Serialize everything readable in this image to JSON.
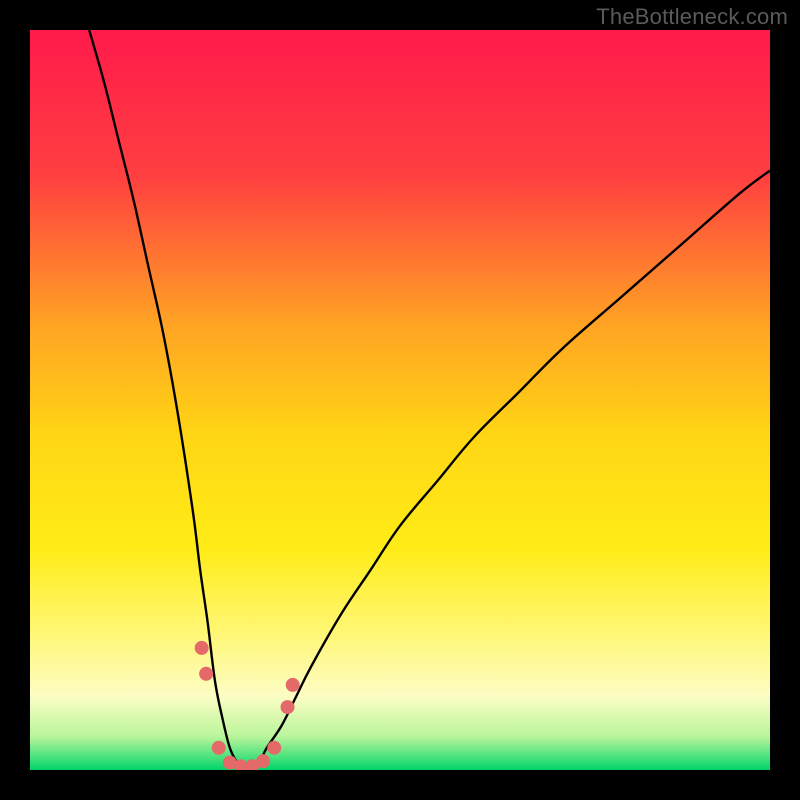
{
  "watermark": "TheBottleneck.com",
  "chart_data": {
    "type": "line",
    "title": "",
    "xlabel": "",
    "ylabel": "",
    "xlim": [
      0,
      100
    ],
    "ylim": [
      0,
      100
    ],
    "background_gradient": {
      "stops": [
        {
          "offset": 0.0,
          "color": "#ff1a4b"
        },
        {
          "offset": 0.2,
          "color": "#ff4040"
        },
        {
          "offset": 0.4,
          "color": "#ffa423"
        },
        {
          "offset": 0.55,
          "color": "#ffd614"
        },
        {
          "offset": 0.7,
          "color": "#ffec17"
        },
        {
          "offset": 0.82,
          "color": "#fff77a"
        },
        {
          "offset": 0.9,
          "color": "#fdfdc4"
        },
        {
          "offset": 0.955,
          "color": "#b8f59a"
        },
        {
          "offset": 0.985,
          "color": "#3fe07a"
        },
        {
          "offset": 1.0,
          "color": "#00d46a"
        }
      ]
    },
    "series": [
      {
        "name": "bottleneck-curve",
        "color": "#000000",
        "stroke_width": 2.4,
        "x": [
          8,
          10,
          12,
          14,
          16,
          18,
          20,
          22,
          23,
          24,
          25,
          26,
          27,
          28,
          29,
          30,
          31,
          32,
          34,
          36,
          38,
          42,
          46,
          50,
          55,
          60,
          66,
          72,
          80,
          88,
          96,
          100
        ],
        "y": [
          100,
          93,
          85,
          77,
          68,
          59,
          48,
          35,
          27,
          20,
          12,
          7,
          3,
          1,
          0,
          0,
          1,
          3,
          6,
          10,
          14,
          21,
          27,
          33,
          39,
          45,
          51,
          57,
          64,
          71,
          78,
          81
        ]
      }
    ],
    "markers": {
      "name": "highlight-points",
      "color": "#e46a6a",
      "radius": 7,
      "points": [
        {
          "x": 23.2,
          "y": 16.5
        },
        {
          "x": 23.8,
          "y": 13.0
        },
        {
          "x": 25.5,
          "y": 3.0
        },
        {
          "x": 27.0,
          "y": 1.0
        },
        {
          "x": 28.5,
          "y": 0.5
        },
        {
          "x": 30.0,
          "y": 0.5
        },
        {
          "x": 31.5,
          "y": 1.2
        },
        {
          "x": 33.0,
          "y": 3.0
        },
        {
          "x": 34.8,
          "y": 8.5
        },
        {
          "x": 35.5,
          "y": 11.5
        }
      ]
    }
  }
}
